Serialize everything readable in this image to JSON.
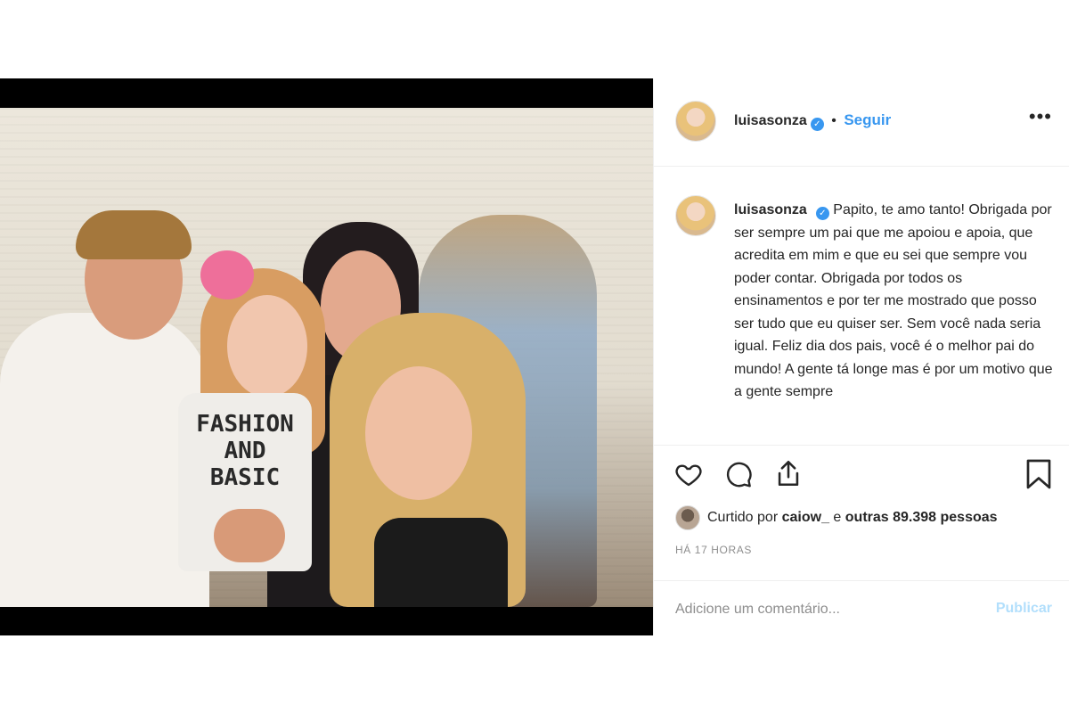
{
  "post": {
    "media": {
      "description_icon": "photo",
      "shirt_text_line1": "FASHION",
      "shirt_text_line2": "AND",
      "shirt_text_line3": "BASIC"
    },
    "header": {
      "username": "luisasonza",
      "verified_icon": "verified-badge-icon",
      "separator": "•",
      "follow_label": "Seguir",
      "more_icon": "•••"
    },
    "caption": {
      "username": "luisasonza",
      "text": "Papito, te amo tanto! Obrigada por ser sempre um pai que me apoiou e apoia, que acredita em mim e que eu sei que sempre vou poder contar. Obrigada por todos os ensinamentos e por ter me mostrado que posso ser tudo que eu quiser ser. Sem você nada seria igual. Feliz dia dos pais, você é o melhor pai do mundo! A gente tá longe mas é por um motivo que a gente sempre"
    },
    "actions": {
      "like_icon": "heart-icon",
      "comment_icon": "comment-icon",
      "share_icon": "share-icon",
      "save_icon": "bookmark-icon"
    },
    "likes": {
      "prefix": "Curtido por",
      "user": "caiow_",
      "connector": "e",
      "others": "outras 89.398 pessoas"
    },
    "timestamp": "HÁ 17 HORAS",
    "comment_box": {
      "placeholder": "Adicione um comentário...",
      "publish_label": "Publicar"
    },
    "colors": {
      "accent": "#3897f0",
      "publish_disabled": "#b2dffc",
      "secondary_text": "#8e8e8e"
    }
  }
}
